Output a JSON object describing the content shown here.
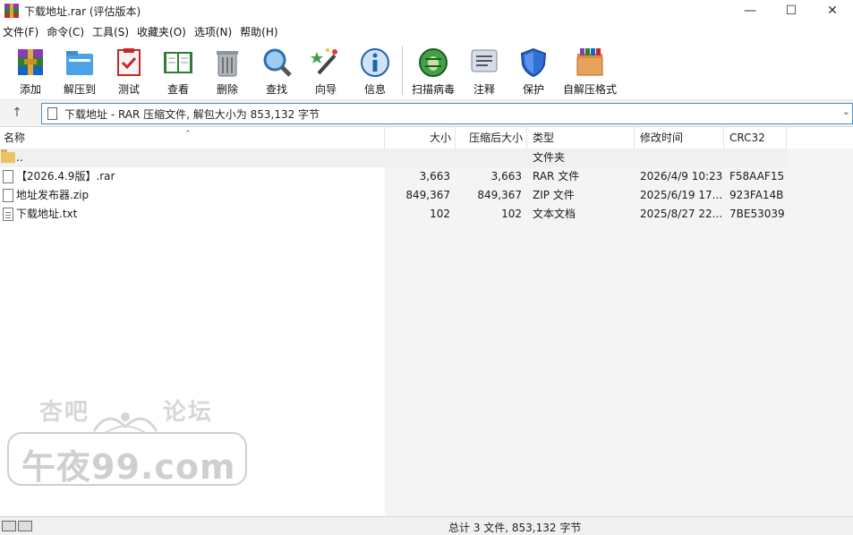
{
  "window": {
    "title": "下载地址.rar (评估版本)"
  },
  "menu": [
    "文件(F)",
    "命令(C)",
    "工具(S)",
    "收藏夹(O)",
    "选项(N)",
    "帮助(H)"
  ],
  "toolbar": {
    "buttons": [
      {
        "label": "添加",
        "icon": "add-archive-icon"
      },
      {
        "label": "解压到",
        "icon": "extract-to-icon"
      },
      {
        "label": "测试",
        "icon": "test-icon"
      },
      {
        "label": "查看",
        "icon": "view-icon"
      },
      {
        "label": "删除",
        "icon": "delete-icon"
      },
      {
        "label": "查找",
        "icon": "find-icon"
      },
      {
        "label": "向导",
        "icon": "wizard-icon"
      },
      {
        "label": "信息",
        "icon": "info-icon"
      },
      {
        "label": "扫描病毒",
        "icon": "virus-scan-icon"
      },
      {
        "label": "注释",
        "icon": "comment-icon"
      },
      {
        "label": "保护",
        "icon": "protect-icon"
      },
      {
        "label": "自解压格式",
        "icon": "sfx-icon"
      }
    ]
  },
  "address": {
    "text": "下载地址 - RAR 压缩文件, 解包大小为 853,132 字节"
  },
  "columns": [
    "名称",
    "大小",
    "压缩后大小",
    "类型",
    "修改时间",
    "CRC32"
  ],
  "rows": [
    {
      "name": "..",
      "size": "",
      "packed": "",
      "type": "文件夹",
      "modified": "",
      "crc": "",
      "icon": "folder-icon"
    },
    {
      "name": "【2026.4.9版】.rar",
      "size": "3,663",
      "packed": "3,663",
      "type": "RAR 文件",
      "modified": "2026/4/9 10:23",
      "crc": "F58AAF15",
      "icon": "file-icon"
    },
    {
      "name": "地址发布器.zip",
      "size": "849,367",
      "packed": "849,367",
      "type": "ZIP 文件",
      "modified": "2025/6/19 17...",
      "crc": "923FA14B",
      "icon": "file-icon"
    },
    {
      "name": "下载地址.txt",
      "size": "102",
      "packed": "102",
      "type": "文本文档",
      "modified": "2025/8/27 22...",
      "crc": "7BE53039",
      "icon": "text-file-icon"
    }
  ],
  "watermark": {
    "top_left": "杏吧",
    "top_right": "论坛",
    "main": "午夜99.com"
  },
  "status": {
    "text": "总计 3 文件, 853,132 字节"
  },
  "colors": {
    "accent": "#4a90c8",
    "selection": "#f0f0f0"
  }
}
